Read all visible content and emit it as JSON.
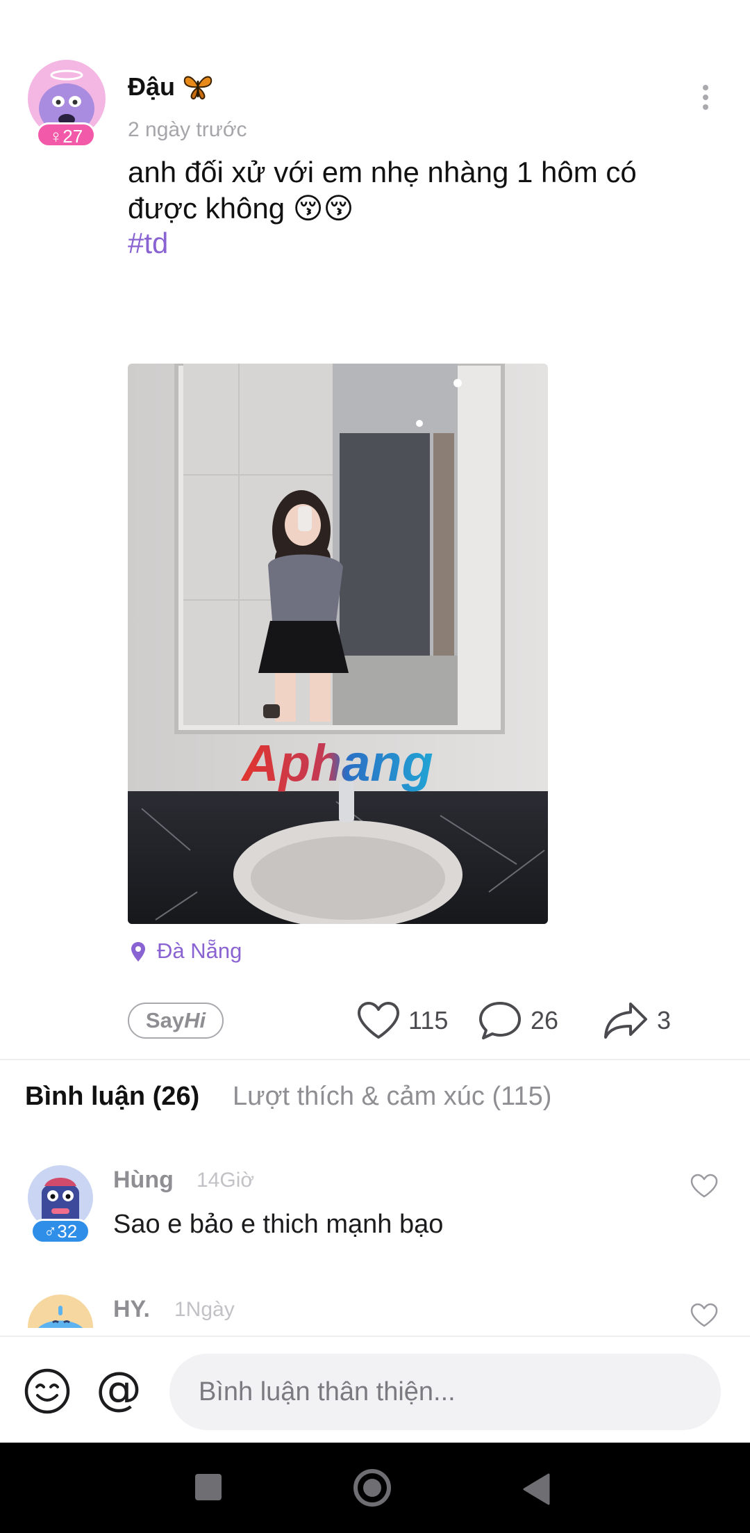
{
  "post": {
    "author": "Đậu",
    "age_badge": "27",
    "time": "2 ngày trước",
    "text_line1": "anh đối xử với em nhẹ nhàng 1 hôm có",
    "text_line2": "được không 😚😚",
    "hashtag": "#td",
    "photo_watermark": "Aphang",
    "location": "Đà Nẵng",
    "say_hi_prefix": "Say",
    "say_hi_suffix": "Hi",
    "likes": "115",
    "comments": "26",
    "shares": "3"
  },
  "tabs": {
    "comments": "Bình luận (26)",
    "likes": "Lượt thích & cảm xúc (115)"
  },
  "comment_list": [
    {
      "name": "Hùng",
      "time": "14Giờ",
      "badge": "32",
      "gender": "♂",
      "text": "Sao e bảo e thich mạnh bạo"
    },
    {
      "name": "HY.",
      "time": "1Ngày"
    }
  ],
  "input": {
    "placeholder": "Bình luận thân thiện...",
    "at_symbol": "@"
  },
  "colors": {
    "accent_purple": "#8a63d2",
    "female_badge": "#f25aa9",
    "male_badge": "#2f8ee8"
  },
  "icons": [
    "butterfly-icon",
    "more-icon",
    "location-pin-icon",
    "heart-icon",
    "comment-bubble-icon",
    "share-arrow-icon",
    "smiley-icon",
    "nav-recent-icon",
    "nav-home-icon",
    "nav-back-icon"
  ]
}
